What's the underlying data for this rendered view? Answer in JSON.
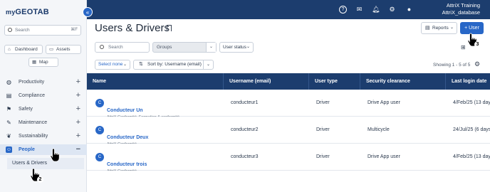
{
  "sidebar": {
    "logo_prefix": "my",
    "logo_main": "GEOTAB",
    "search_placeholder": "Search",
    "search_shortcut": "⌘F",
    "dashboard_label": "Dashboard",
    "assets_label": "Assets",
    "map_label": "Map",
    "items": [
      {
        "label": "Productivity",
        "icon": "globe-icon"
      },
      {
        "label": "Compliance",
        "icon": "clipboard-icon"
      },
      {
        "label": "Safety",
        "icon": "road-icon"
      },
      {
        "label": "Maintenance",
        "icon": "wrench-icon"
      },
      {
        "label": "Sustainability",
        "icon": "leaf-icon"
      },
      {
        "label": "People",
        "icon": "people-icon"
      }
    ],
    "sub_item": "Users & Drivers"
  },
  "header": {
    "user_name": "AttriX Training",
    "database": "AttriX_database"
  },
  "page": {
    "title": "Users & Drivers",
    "reports_label": "Reports",
    "add_user_label": "User",
    "search_placeholder": "Search",
    "groups_placeholder": "Groups",
    "user_status_label": "User status",
    "select_label": "Select none",
    "sort_label": "Sort by: Username (email)",
    "showing": "Showing 1 - 5 of 5"
  },
  "table": {
    "columns": [
      "Name",
      "Username (email)",
      "User type",
      "Security clearance",
      "Last login date"
    ],
    "rows": [
      {
        "initial": "C",
        "name": "Conducteur Un",
        "sub": "AttriX Conformité, Formation & conformité",
        "username": "conducteur1",
        "type": "Driver",
        "clearance": "Drive App user",
        "last_login": "4/Feb/25 (13 days"
      },
      {
        "initial": "C",
        "name": "Conducteur Deux",
        "sub": "AttriX Conformité",
        "username": "conducteur2",
        "type": "Driver",
        "clearance": "Multicycle",
        "last_login": "24/Jul/25 (6 days"
      },
      {
        "initial": "C",
        "name": "Conducteur trois",
        "sub": "AttriX Conformité",
        "username": "conducteur3",
        "type": "Driver",
        "clearance": "Drive App user",
        "last_login": "4/Feb/25 (13 days"
      }
    ]
  },
  "annotations": {
    "step2": "2",
    "step3": "3"
  }
}
